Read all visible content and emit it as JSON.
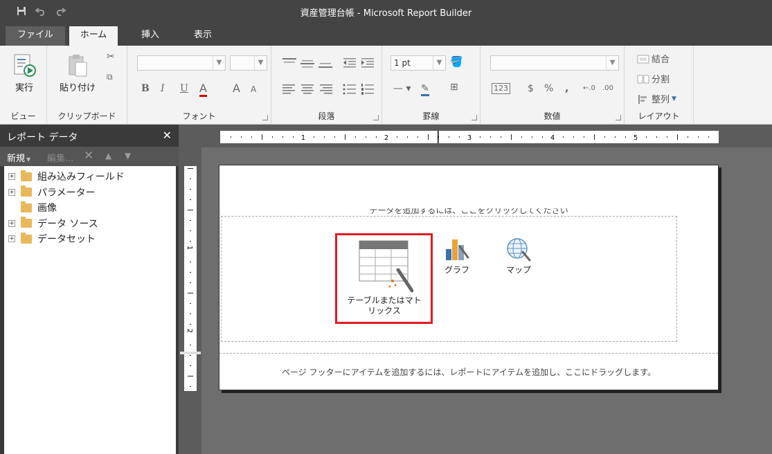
{
  "window": {
    "title": "資産管理台帳 - Microsoft Report Builder",
    "qat_icons": [
      "save-icon",
      "undo-icon",
      "redo-icon"
    ]
  },
  "tabs": [
    {
      "label": "ファイル"
    },
    {
      "label": "ホーム"
    },
    {
      "label": "挿入"
    },
    {
      "label": "表示"
    }
  ],
  "ribbon": {
    "view": {
      "run_label": "実行",
      "group_label": "ビュー"
    },
    "clipboard": {
      "paste_label": "貼り付け",
      "group_label": "クリップボード"
    },
    "font": {
      "group_label": "フォント",
      "bold": "B",
      "italic": "I",
      "underline": "U",
      "color": "A",
      "grow": "A",
      "shrink": "A"
    },
    "paragraph": {
      "group_label": "段落"
    },
    "border": {
      "group_label": "罫線",
      "size_value": "1 pt"
    },
    "number": {
      "group_label": "数値",
      "currency": "$",
      "percent": "%",
      "comma": ","
    },
    "layout": {
      "group_label": "レイアウト",
      "merge_label": "結合",
      "split_label": "分割",
      "arrange_label": "整列"
    }
  },
  "report_data_panel": {
    "title": "レポート データ",
    "toolbar": {
      "new_label": "新規",
      "edit_label": "編集..."
    },
    "tree": [
      {
        "label": "組み込みフィールド",
        "expandable": true
      },
      {
        "label": "パラメーター",
        "expandable": true
      },
      {
        "label": "画像",
        "expandable": false
      },
      {
        "label": "データ ソース",
        "expandable": true
      },
      {
        "label": "データセット",
        "expandable": true
      }
    ]
  },
  "ruler": {
    "h_numbers": [
      "1",
      "2",
      "3",
      "4",
      "5"
    ],
    "v_numbers": [
      "1",
      "2"
    ]
  },
  "design": {
    "body_hint": "データを追加するには、ここをクリックしてください",
    "footer_hint": "ページ フッターにアイテムを追加するには、レポートにアイテムを追加し、ここにドラッグします。",
    "wizards": [
      {
        "label": "テーブルまたはマト\nリックス"
      },
      {
        "label": "グラフ"
      },
      {
        "label": "マップ"
      }
    ]
  },
  "colors": {
    "highlight": "#e01b24",
    "folder": "#e8b85c",
    "chrome_dark": "#444444"
  }
}
